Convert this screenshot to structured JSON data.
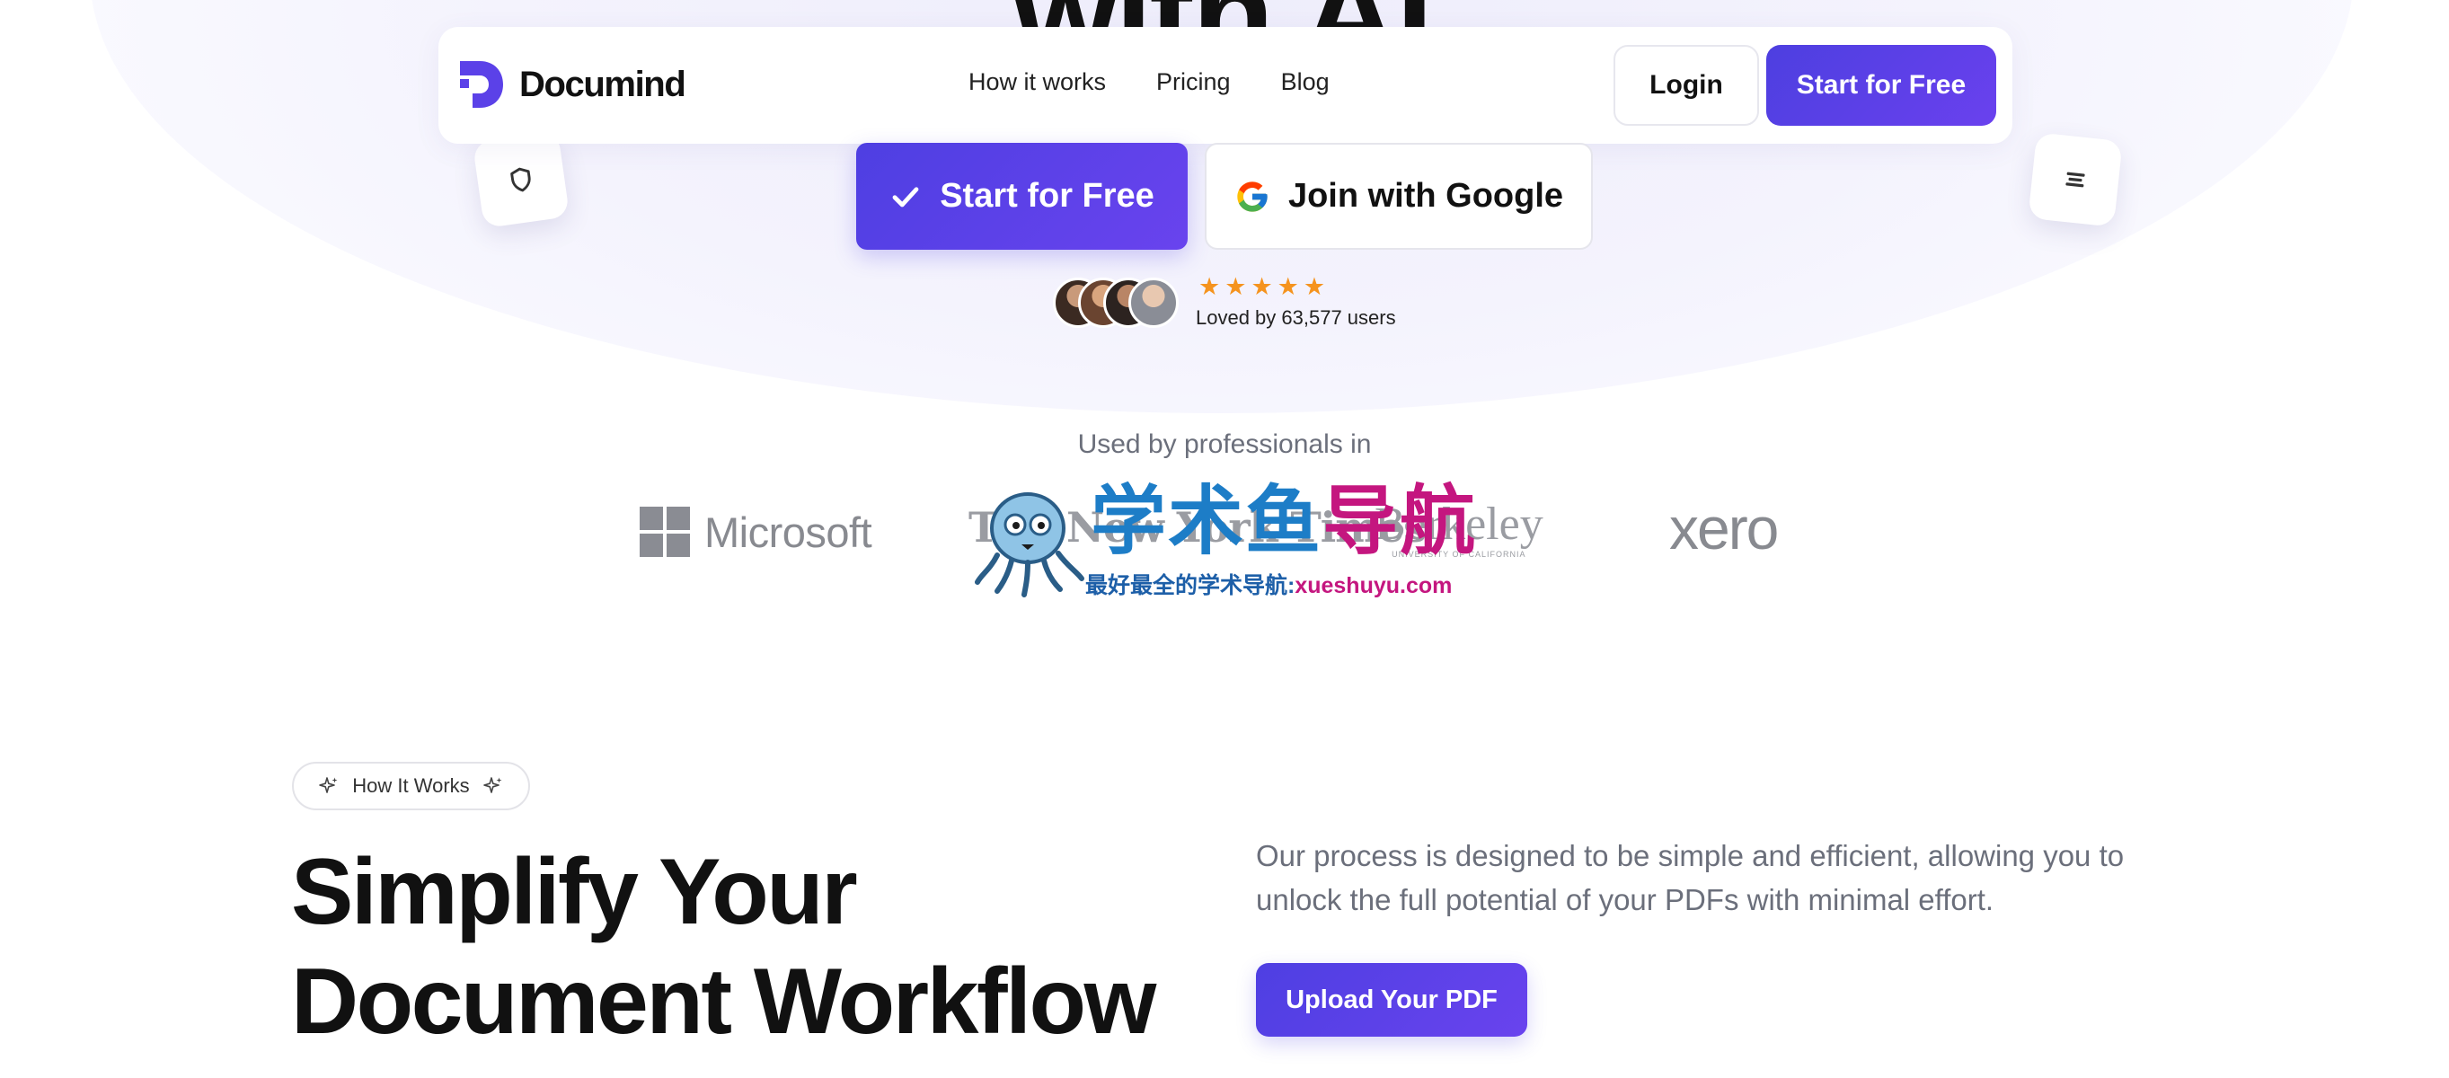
{
  "hero": {
    "title_fragment": "with AI",
    "cta_primary": "Start for Free",
    "cta_google": "Join with Google",
    "rating_stars": 5,
    "loved_text": "Loved by 63,577 users"
  },
  "navbar": {
    "brand": "Documind",
    "links": [
      "How it works",
      "Pricing",
      "Blog"
    ],
    "login_label": "Login",
    "start_label": "Start for Free"
  },
  "logos_section": {
    "heading": "Used by professionals in",
    "companies": [
      "Microsoft",
      "The New York Times",
      "Berkeley",
      "xero"
    ],
    "berkeley_sub": "UNIVERSITY OF CALIFORNIA"
  },
  "watermark": {
    "title_part1": "学术鱼",
    "title_part2": "导航",
    "subtitle": "最好最全的学术导航:",
    "url": "xueshuyu.com"
  },
  "how_it_works": {
    "badge": "How It Works",
    "title_line1": "Simplify Your",
    "title_line2": "Document Workflow",
    "description": "Our process is designed to be simple and efficient, allowing you to unlock the full potential of your PDFs with minimal effort.",
    "upload_label": "Upload Your PDF"
  },
  "colors": {
    "accent": "#5b41e8",
    "star": "#f5931e",
    "muted_text": "#6b6f7b"
  },
  "icons": [
    "shield-icon",
    "menu-lines-icon",
    "check-icon",
    "google-icon",
    "sparkle-icon",
    "star-icon"
  ]
}
